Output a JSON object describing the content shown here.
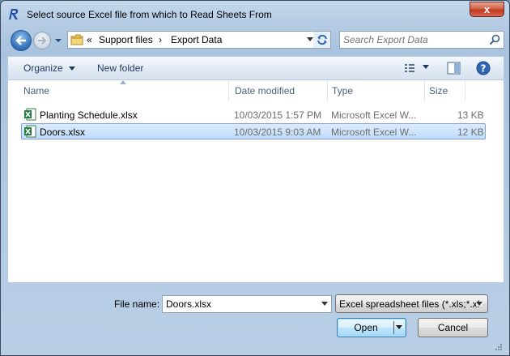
{
  "window": {
    "title": "Select source Excel file from which to Read Sheets From",
    "close_label": "x"
  },
  "address": {
    "prefix": "«",
    "crumbs": [
      "Support files",
      "Export Data"
    ],
    "separator": "›"
  },
  "search": {
    "placeholder": "Search Export Data"
  },
  "toolbar": {
    "organize_label": "Organize",
    "new_folder_label": "New folder"
  },
  "columns": {
    "name": "Name",
    "date": "Date modified",
    "type": "Type",
    "size": "Size"
  },
  "files": [
    {
      "name": "Planting Schedule.xlsx",
      "date": "10/03/2015 1:57 PM",
      "type": "Microsoft Excel W...",
      "size": "13 KB",
      "selected": false
    },
    {
      "name": "Doors.xlsx",
      "date": "10/03/2015 9:03 AM",
      "type": "Microsoft Excel W...",
      "size": "12 KB",
      "selected": true
    }
  ],
  "footer": {
    "file_name_label": "File name:",
    "file_name_value": "Doors.xlsx",
    "filter_value": "Excel spreadsheet files (*.xls;*.xl",
    "open_label": "Open",
    "cancel_label": "Cancel"
  },
  "colors": {
    "accent": "#2f6cb5",
    "selection": "#c1dcfc",
    "excel_green": "#1e7a3a"
  },
  "icons": {
    "app": "revit-r-icon",
    "back": "back-arrow-icon",
    "forward": "forward-arrow-icon",
    "folder": "folder-icon",
    "refresh": "refresh-icon",
    "search": "search-icon",
    "views": "view-options-icon",
    "preview": "preview-pane-icon",
    "help": "help-icon",
    "excel": "excel-file-icon"
  }
}
